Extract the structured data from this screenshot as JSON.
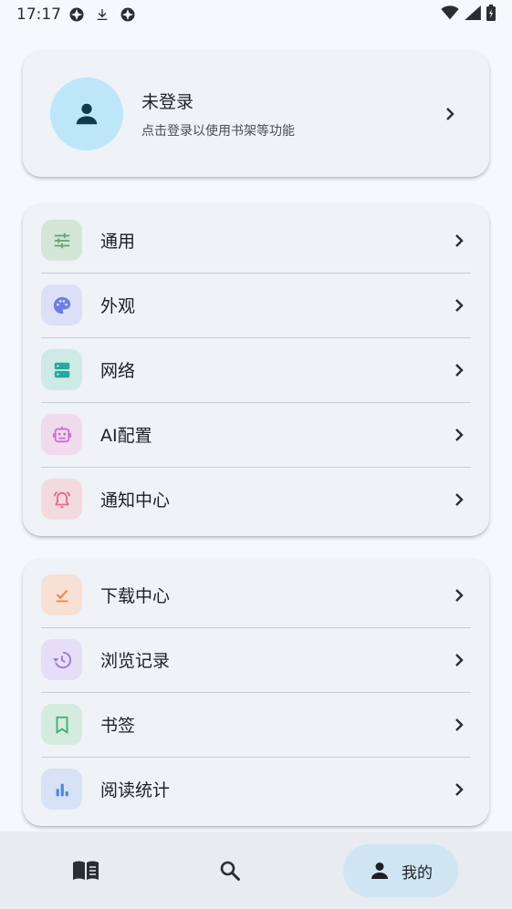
{
  "status_bar": {
    "time": "17:17",
    "left_icons": [
      "sync-icon",
      "download-icon",
      "sync-icon"
    ],
    "right_icons": [
      "wifi-icon",
      "signal-icon",
      "battery-icon"
    ]
  },
  "profile": {
    "name": "未登录",
    "subtitle": "点击登录以使用书架等功能",
    "avatar_icon": "person-icon"
  },
  "settings_menu": [
    {
      "label": "通用",
      "icon": "tune-icon",
      "icon_bg": "#d4e6d8",
      "icon_color": "#6aa37a"
    },
    {
      "label": "外观",
      "icon": "palette-icon",
      "icon_bg": "#dbe0f7",
      "icon_color": "#6c7de3"
    },
    {
      "label": "网络",
      "icon": "storage-icon",
      "icon_bg": "#cdeae7",
      "icon_color": "#25a99a"
    },
    {
      "label": "AI配置",
      "icon": "robot-icon",
      "icon_bg": "#efdaee",
      "icon_color": "#cd6bd0"
    },
    {
      "label": "通知中心",
      "icon": "bell-alert-icon",
      "icon_bg": "#f3dade",
      "icon_color": "#e46a87"
    }
  ],
  "tools_menu": [
    {
      "label": "下载中心",
      "icon": "download-done-icon",
      "icon_bg": "#f6e1d4",
      "icon_color": "#ec8a45"
    },
    {
      "label": "浏览记录",
      "icon": "history-icon",
      "icon_bg": "#e6ddf6",
      "icon_color": "#9a74df"
    },
    {
      "label": "书签",
      "icon": "bookmark-icon",
      "icon_bg": "#d5ebdd",
      "icon_color": "#3fae72"
    },
    {
      "label": "阅读统计",
      "icon": "bar-chart-icon",
      "icon_bg": "#d7e2f6",
      "icon_color": "#4f86e4"
    }
  ],
  "bottom_nav": {
    "items": [
      {
        "name": "bookshelf",
        "icon": "book-icon",
        "label": ""
      },
      {
        "name": "search",
        "icon": "search-icon",
        "label": ""
      },
      {
        "name": "mine",
        "icon": "person-icon",
        "label": "我的"
      }
    ],
    "active": "mine"
  },
  "colors": {
    "background": "#f6f8fc",
    "card": "#eff2f7",
    "avatar_bg": "#bde6f9",
    "nav_active_bg": "#cfe6f2"
  }
}
